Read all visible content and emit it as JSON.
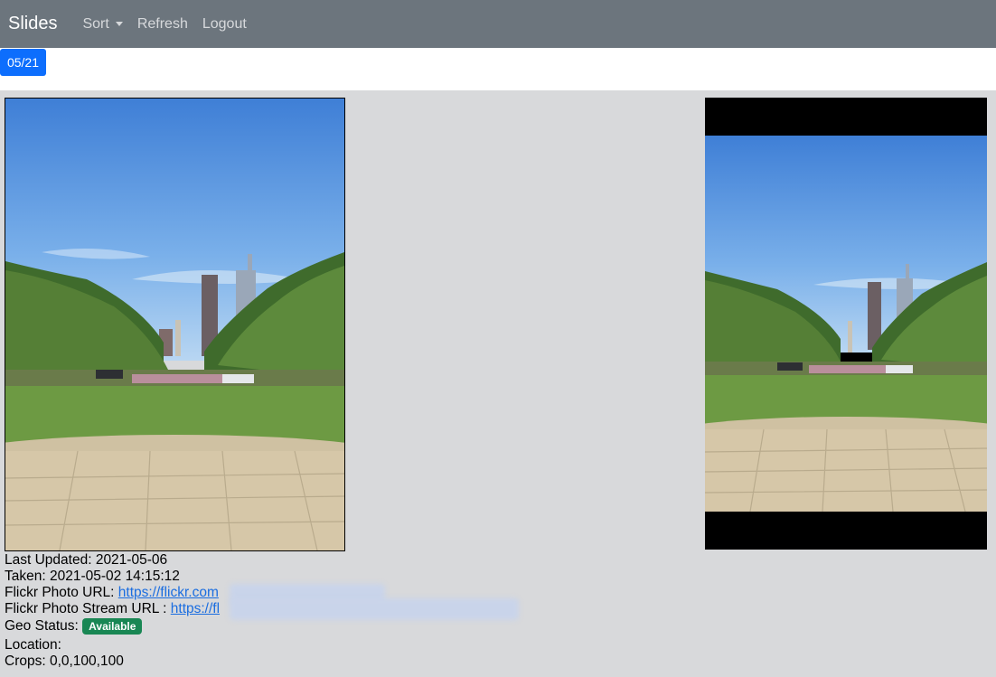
{
  "navbar": {
    "brand": "Slides",
    "items": [
      "Sort",
      "Refresh",
      "Logout"
    ]
  },
  "date_button": "05/21",
  "info": {
    "last_updated": "Last Updated: 2021-05-06",
    "taken": "Taken: 2021-05-02 14:15:12",
    "flickr_photo_label": "Flickr Photo URL: ",
    "flickr_photo_url": "https://flickr.com",
    "flickr_stream_label": "Flickr Photo Stream URL : ",
    "flickr_stream_url": "https://fl",
    "geo_label": "Geo Status: ",
    "geo_status": "Available",
    "location": "Location:",
    "crops": "Crops: 0,0,100,100"
  },
  "colors": {
    "navbar": "#6c757d",
    "primary": "#0d6efd",
    "success": "#198754",
    "link": "#1a6de0"
  }
}
